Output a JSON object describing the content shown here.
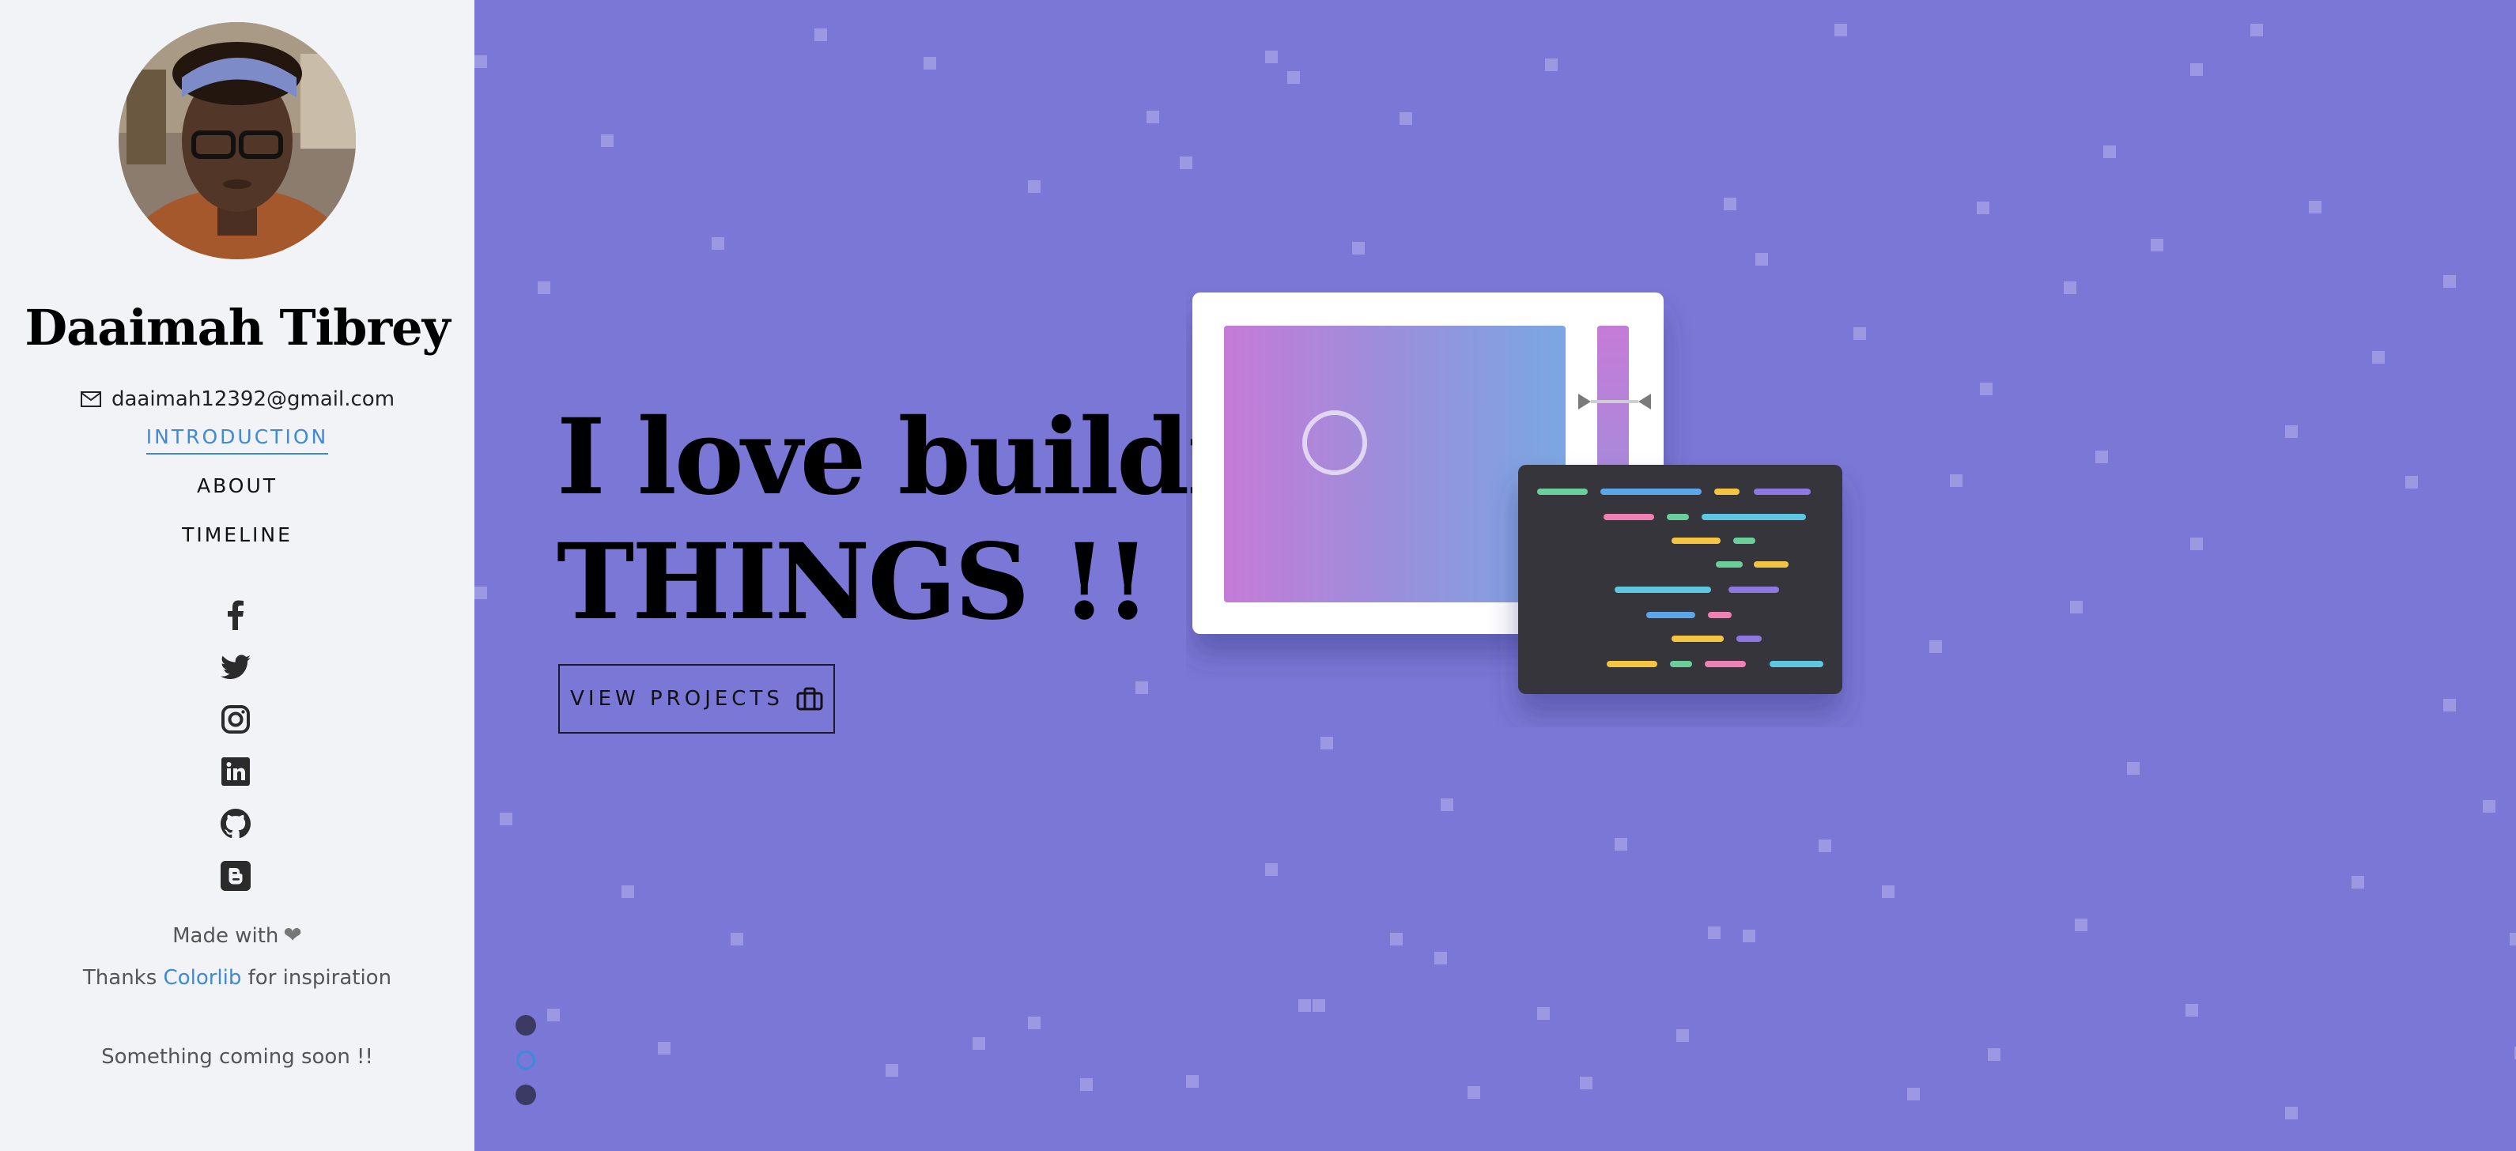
{
  "sidebar": {
    "name": "Daaimah Tibrey",
    "email": "daaimah12392@gmail.com",
    "nav": [
      {
        "label": "INTRODUCTION",
        "active": true
      },
      {
        "label": "ABOUT",
        "active": false
      },
      {
        "label": "TIMELINE",
        "active": false
      }
    ],
    "social_icons": [
      "facebook-icon",
      "twitter-icon",
      "instagram-icon",
      "linkedin-icon",
      "github-icon",
      "blogger-icon"
    ],
    "made_with": "Made with",
    "thanks_prefix": "Thanks",
    "thanks_link": "Colorlib",
    "thanks_suffix": "for inspiration",
    "coming_soon": "Something coming soon !!"
  },
  "hero": {
    "headline_line1": "I love building",
    "headline_line2": "THINGS !!",
    "cta_label": "VIEW PROJECTS",
    "pager": [
      {
        "active": false
      },
      {
        "active": true
      },
      {
        "active": false
      }
    ]
  },
  "colors": {
    "accent": "#3f8ad8",
    "hero_bg": "#7b77d6",
    "sidebar_bg": "#f2f3f7"
  }
}
